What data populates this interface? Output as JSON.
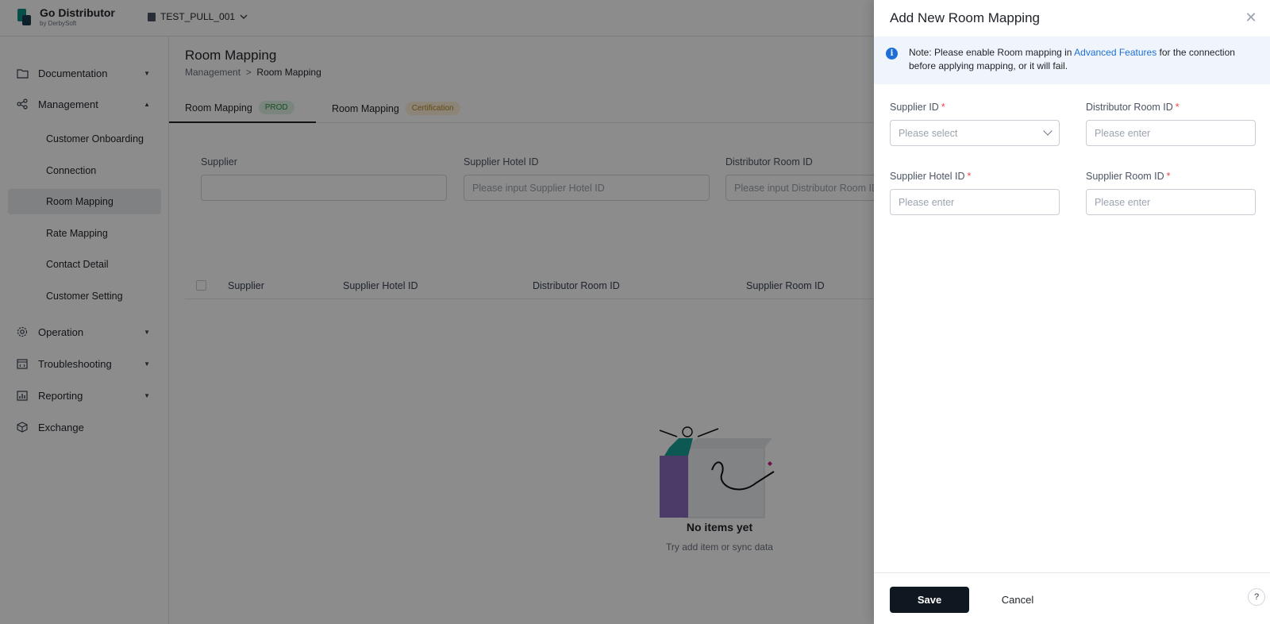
{
  "app": {
    "name": "Go Distributor",
    "by": "by DerbySoft",
    "env": "TEST_PULL_001"
  },
  "sidebar": {
    "items": [
      {
        "label": "Documentation",
        "icon": "folder-icon"
      },
      {
        "label": "Management",
        "icon": "share-icon"
      },
      {
        "label": "Operation",
        "icon": "gear-icon"
      },
      {
        "label": "Troubleshooting",
        "icon": "code-window-icon"
      },
      {
        "label": "Reporting",
        "icon": "report-icon"
      },
      {
        "label": "Exchange",
        "icon": "cube-icon"
      }
    ],
    "sub": [
      "Customer Onboarding",
      "Connection",
      "Room Mapping",
      "Rate Mapping",
      "Contact Detail",
      "Customer Setting"
    ]
  },
  "page": {
    "title": "Room Mapping",
    "breadcrumb": {
      "parent": "Management",
      "sep": ">",
      "current": "Room Mapping"
    },
    "tabs": [
      {
        "label": "Room Mapping",
        "badge": "PROD"
      },
      {
        "label": "Room Mapping",
        "badge": "Certification"
      }
    ],
    "filters": {
      "supplier_label": "Supplier",
      "hotel_label": "Supplier Hotel ID",
      "hotel_placeholder": "Please input Supplier Hotel ID",
      "room_label": "Distributor Room ID",
      "room_placeholder": "Please input Distributor Room ID"
    },
    "table": {
      "columns": [
        "Supplier",
        "Supplier Hotel ID",
        "Distributor Room ID",
        "Supplier Room ID"
      ]
    },
    "empty": {
      "title": "No items yet",
      "subtitle": "Try add item or sync data"
    }
  },
  "drawer": {
    "title": "Add New Room Mapping",
    "note": {
      "prefix": "Note: Please enable Room mapping in ",
      "link": "Advanced Features",
      "suffix": " for the connection before applying mapping, or it will fail."
    },
    "fields": {
      "supplier_id": {
        "label": "Supplier ID",
        "placeholder": "Please select"
      },
      "distributor_room_id": {
        "label": "Distributor Room ID",
        "placeholder": "Please enter"
      },
      "supplier_hotel_id": {
        "label": "Supplier Hotel ID",
        "placeholder": "Please enter"
      },
      "supplier_room_id": {
        "label": "Supplier Room ID",
        "placeholder": "Please enter"
      }
    },
    "required_mark": "*",
    "save": "Save",
    "cancel": "Cancel",
    "help": "?"
  },
  "colors": {
    "accent": "#1d6fd6",
    "primary_button": "#0f1720",
    "prod_badge": "#2f8f46",
    "cert_badge": "#b7852b",
    "required": "#e5484d"
  }
}
